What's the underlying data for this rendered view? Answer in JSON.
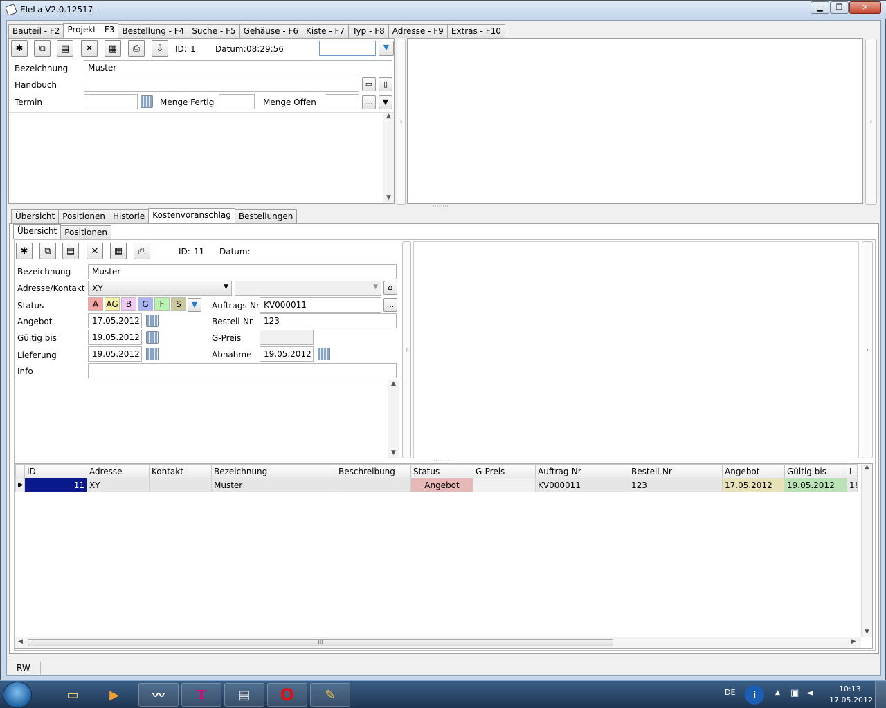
{
  "window": {
    "title": "EleLa V2.0.12517 -"
  },
  "main_tabs": [
    "Bauteil - F2",
    "Projekt - F3",
    "Bestellung - F4",
    "Suche - F5",
    "Gehäuse - F6",
    "Kiste - F7",
    "Typ - F8",
    "Adresse - F9",
    "Extras - F10"
  ],
  "projekt": {
    "id_label": "ID:",
    "id_value": "1",
    "datum_label": "Datum:",
    "datum_value": "08:29:56",
    "search_value": "",
    "bezeichnung_label": "Bezeichnung",
    "bezeichnung_value": "Muster",
    "handbuch_label": "Handbuch",
    "handbuch_value": "",
    "termin_label": "Termin",
    "termin_value": "",
    "menge_fertig_label": "Menge Fertig",
    "menge_fertig_value": "",
    "menge_offen_label": "Menge Offen",
    "menge_offen_value": "",
    "ellipsis": "...",
    "dropdown_glyph": "▼"
  },
  "sub_tabs": [
    "Übersicht",
    "Positionen",
    "Historie",
    "Kostenvoranschlag",
    "Bestellungen"
  ],
  "inner_tabs": [
    "Übersicht",
    "Positionen"
  ],
  "kv": {
    "id_label": "ID:",
    "id_value": "11",
    "datum_label": "Datum:",
    "datum_value": "",
    "bezeichnung_label": "Bezeichnung",
    "bezeichnung_value": "Muster",
    "adresse_label": "Adresse/Kontakt",
    "adresse_value": "XY",
    "kontakt_value": "",
    "status_label": "Status",
    "status_buttons": [
      {
        "label": "A",
        "color": "#f4a6a6"
      },
      {
        "label": "AG",
        "color": "#f7f2a4"
      },
      {
        "label": "B",
        "color": "#f2c8f4"
      },
      {
        "label": "G",
        "color": "#a9b4f4"
      },
      {
        "label": "F",
        "color": "#b8f4b0"
      },
      {
        "label": "S",
        "color": "#c9c99a"
      }
    ],
    "auftrags_label": "Auftrags-Nr",
    "auftrags_value": "KV000011",
    "angebot_label": "Angebot",
    "angebot_value": "17.05.2012",
    "bestell_label": "Bestell-Nr",
    "bestell_value": "123",
    "gueltig_label": "Gültig bis",
    "gueltig_value": "19.05.2012",
    "gpreis_label": "G-Preis",
    "gpreis_value": "",
    "lieferung_label": "Lieferung",
    "lieferung_value": "19.05.2012",
    "abnahme_label": "Abnahme",
    "abnahme_value": "19.05.2012",
    "info_label": "Info",
    "info_value": "",
    "ellipsis": "..."
  },
  "grid": {
    "columns": [
      "ID",
      "Adresse",
      "Kontakt",
      "Bezeichnung",
      "Beschreibung",
      "Status",
      "G-Preis",
      "Auftrag-Nr",
      "Bestell-Nr",
      "Angebot",
      "Gültig bis",
      "L"
    ],
    "row": {
      "id": "11",
      "adresse": "XY",
      "kontakt": "",
      "bezeichnung": "Muster",
      "beschreibung": "",
      "status": "Angebot",
      "gpreis": "",
      "auftrag": "KV000011",
      "bestell": "123",
      "angebot": "17.05.2012",
      "gueltig": "19.05.2012",
      "extra": "1!"
    },
    "scroll_grip": "III"
  },
  "statusbar": {
    "mode": "RW"
  },
  "taskbar": {
    "tmobile": "T",
    "opera": "O",
    "lang": "DE",
    "time": "10:13",
    "date": "17.05.2012"
  },
  "colors": {
    "selected_cell": "#0a1a8c",
    "status_cell": "#e6b8b8",
    "angebot_cell": "#e8e2b8",
    "gueltig_cell": "#b9e3b5"
  }
}
